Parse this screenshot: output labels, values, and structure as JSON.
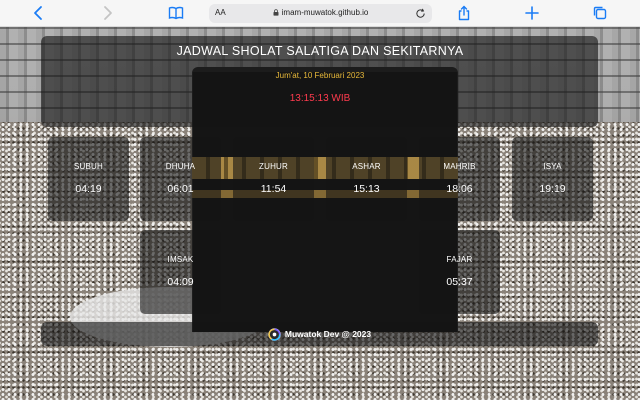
{
  "browser": {
    "text_size_label": "AA",
    "url": "imam-muwatok.github.io"
  },
  "header": {
    "title": "JADWAL SHOLAT SALATIGA DAN SEKITARNYA",
    "date": "Jum'at, 10 Februari 2023",
    "clock": "13:15:13 WIB"
  },
  "prayers": [
    {
      "name": "SUBUH",
      "time": "04:19"
    },
    {
      "name": "DHUHA",
      "time": "06:01"
    },
    {
      "name": "ZUHUR",
      "time": "11:54"
    },
    {
      "name": "ASHAR",
      "time": "15:13"
    },
    {
      "name": "MAHRIB",
      "time": "18:06"
    },
    {
      "name": "ISYA",
      "time": "19:19"
    },
    {
      "name": "IMSAK",
      "time": "04:09"
    },
    {
      "name": "FAJAR",
      "time": "05:37"
    }
  ],
  "footer": {
    "text": "Muwatok Dev @ 2023"
  },
  "colors": {
    "date": "#e8b93a",
    "clock": "#ff3b4e",
    "toolbar_icon": "#1a7cf5"
  }
}
